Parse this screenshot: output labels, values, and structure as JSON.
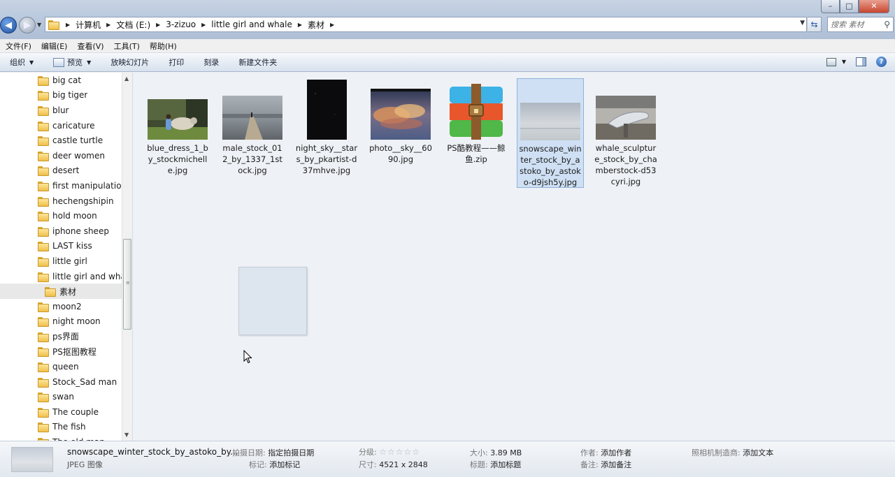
{
  "window": {
    "controls": {
      "minimize": "–",
      "maximize": "□",
      "close": "✕"
    }
  },
  "address": {
    "crumbs": [
      "计算机",
      "文档 (E:)",
      "3-zizuo",
      "little girl and whale",
      "素材"
    ],
    "search_placeholder": "搜索 素材"
  },
  "menu": [
    "文件(F)",
    "编辑(E)",
    "查看(V)",
    "工具(T)",
    "帮助(H)"
  ],
  "toolbar": {
    "organize": "组织",
    "preview": "预览",
    "slideshow": "放映幻灯片",
    "print": "打印",
    "burn": "刻录",
    "new_folder": "新建文件夹"
  },
  "tree": [
    "big cat",
    "big tiger",
    "blur",
    "caricature",
    "castle turtle",
    "deer women",
    "desert",
    "first manipulation",
    "hechengshipin",
    "hold moon",
    "iphone sheep",
    "LAST kiss",
    "little girl",
    "little girl and whale",
    "素材",
    "moon2",
    "night moon",
    "ps界面",
    "PS抠图教程",
    "queen",
    "Stock_Sad man",
    "swan",
    "The couple",
    "The fish",
    "The old man"
  ],
  "files": [
    {
      "name": "blue_dress_1_by_stockmichelle.jpg",
      "thumb": "photo-girl-sheep"
    },
    {
      "name": "male_stock_012_by_1337_1stock.jpg",
      "thumb": "photo-pier"
    },
    {
      "name": "night_sky__stars_by_pkartist-d37mhve.jpg",
      "thumb": "photo-night-sky"
    },
    {
      "name": "photo__sky__6090.jpg",
      "thumb": "photo-sunset-clouds"
    },
    {
      "name": "PS酷教程——鲸鱼.zip",
      "thumb": "winrar-archive-icon"
    },
    {
      "name": "snowscape_winter_stock_by_astoko_by_astoko-d9jsh5y.jpg",
      "thumb": "photo-snowscape",
      "selected": true
    },
    {
      "name": "whale_sculpture_stock_by_chamberstock-d53cyri.jpg",
      "thumb": "photo-whale-sculpture"
    }
  ],
  "details": {
    "name": "snowscape_winter_stock_by_astoko_by...",
    "type": "JPEG 图像",
    "date_taken_label": "拍摄日期:",
    "date_taken_value": "指定拍摄日期",
    "tags_label": "标记:",
    "tags_value": "添加标记",
    "rating_label": "分级:",
    "rating_value": "☆☆☆☆☆",
    "dimensions_label": "尺寸:",
    "dimensions_value": "4521 x 2848",
    "size_label": "大小:",
    "size_value": "3.89 MB",
    "title_label": "标题:",
    "title_value": "添加标题",
    "author_label": "作者:",
    "author_value": "添加作者",
    "comments_label": "备注:",
    "comments_value": "添加备注",
    "camera_label": "照相机制造商:",
    "camera_value": "添加文本"
  }
}
